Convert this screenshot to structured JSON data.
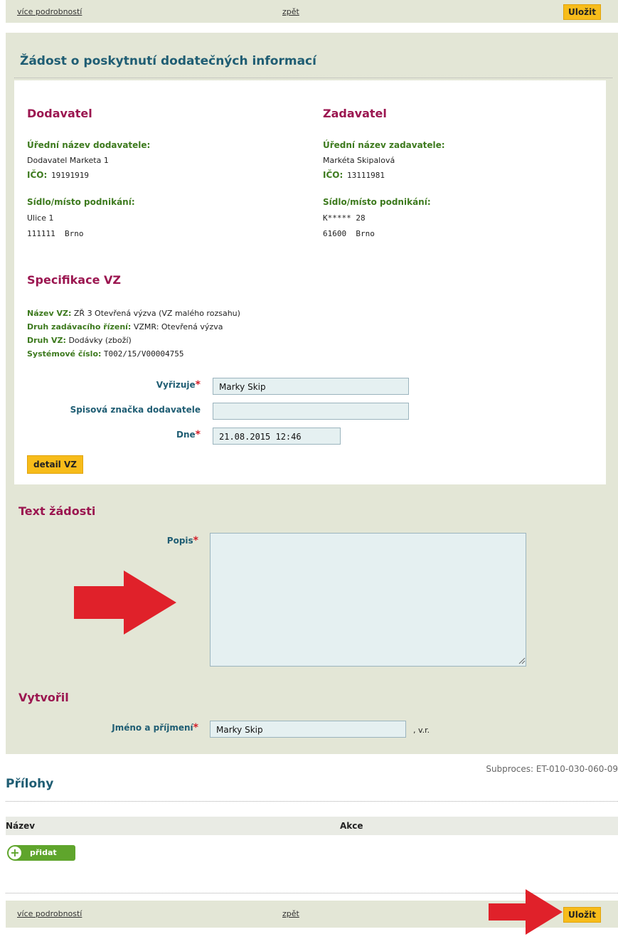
{
  "nav": {
    "more_link": "více podrobností",
    "back_link": "zpět",
    "save_label": "Uložit"
  },
  "form": {
    "title": "Žádost o poskytnutí dodatečných informací",
    "supplier": {
      "heading": "Dodavatel",
      "name_label": "Úřední název dodavatele:",
      "name": "Dodavatel Marketa 1",
      "ico_label": "IČO:",
      "ico": "19191919",
      "seat_label": "Sídlo/místo podnikání:",
      "street": "Ulice 1",
      "zip_city": "111111  Brno"
    },
    "contracting": {
      "heading": "Zadavatel",
      "name_label": "Úřední název zadavatele:",
      "name": "Markéta Skipalová",
      "ico_label": "IČO:",
      "ico": "13111981",
      "seat_label": "Sídlo/místo podnikání:",
      "street": "K***** 28",
      "zip_city": "61600  Brno"
    },
    "spec": {
      "heading": "Specifikace VZ",
      "name_label": "Název VZ:",
      "name": "ZŘ 3 Otevřená výzva (VZ malého rozsahu)",
      "proc_label": "Druh zadávacího řízení:",
      "proc": "VZMR: Otevřená výzva",
      "type_label": "Druh VZ:",
      "type": "Dodávky (zboží)",
      "sys_label": "Systémové číslo:",
      "sys": "T002/15/V00004755"
    },
    "fields": {
      "handler_label": "Vyřizuje",
      "handler": "Marky Skip",
      "fileref_label": "Spisová značka dodavatele",
      "fileref": "",
      "date_label": "Dne",
      "date": "21.08.2015 12:46",
      "required_mark": "*"
    },
    "detail_button": "detail VZ",
    "request": {
      "heading": "Text žádosti",
      "desc_label": "Popis",
      "desc": ""
    },
    "creator": {
      "heading": "Vytvořil",
      "name_label": "Jméno a příjmení",
      "name": "Marky Skip",
      "suffix": ", v.r."
    }
  },
  "attachments": {
    "subproces": "Subproces: ET-010-030-060-09",
    "title": "Přílohy",
    "columns": [
      "Název",
      "Akce"
    ],
    "add_label": "přidat"
  },
  "colors": {
    "arrow": "#e0212a",
    "accent_yellow": "#f7bc1a",
    "panel": "#e3e6d6"
  }
}
